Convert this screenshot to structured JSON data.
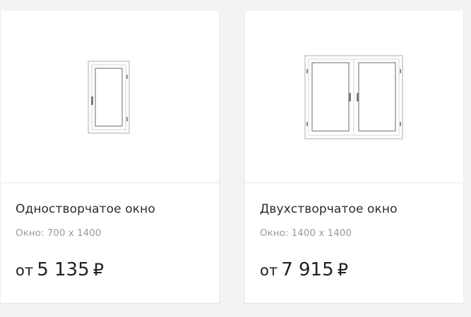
{
  "products": [
    {
      "image": "single-sash-window-icon",
      "title": "Одностворчатое окно",
      "size": "Окно: 700 x 1400",
      "price_prefix": "от",
      "price_value": "5 135",
      "currency": "₽"
    },
    {
      "image": "double-sash-window-icon",
      "title": "Двухстворчатое окно",
      "size": "Окно: 1400 x 1400",
      "price_prefix": "от",
      "price_value": "7 915",
      "currency": "₽"
    }
  ]
}
